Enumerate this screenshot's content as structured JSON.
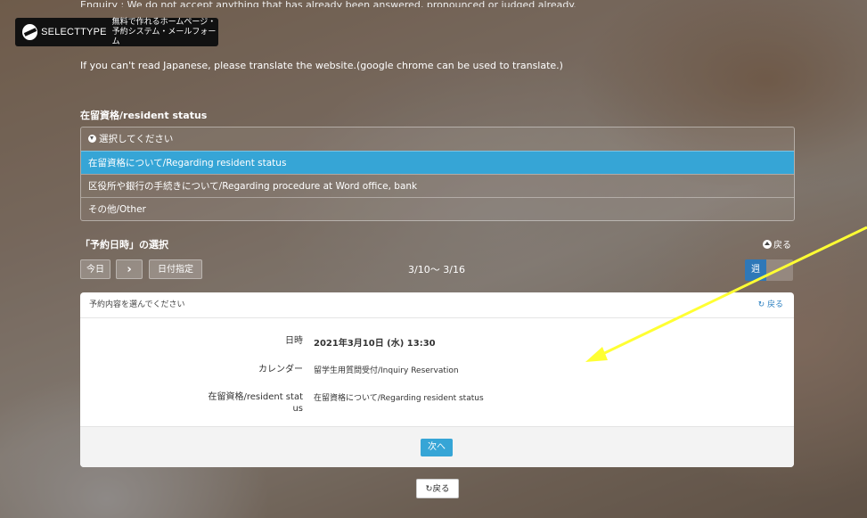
{
  "brand": {
    "name": "SELECTTYPE",
    "tagline_line1": "無料で作れるホームページ・",
    "tagline_line2": "予約システム・メールフォーム"
  },
  "top_partial_text": "Enquiry : We do not accept anything that has already been answered, pronounced or judged already.",
  "notice": "If you can't read Japanese, please translate the website.(google chrome can be used to translate.)",
  "resident_section": {
    "label": "在留資格/resident status",
    "options": [
      {
        "label": "選択してください",
        "placeholder": true
      },
      {
        "label": "在留資格について/Regarding resident status",
        "selected": true
      },
      {
        "label": "区役所や銀行の手続きについて/Regarding procedure at Word office, bank"
      },
      {
        "label": "その他/Other"
      }
    ]
  },
  "datetime_section": {
    "label": "「予約日時」の選択",
    "back_label": "戻る",
    "today_label": "今日",
    "next_arrow": "›",
    "date_pick_label": "日付指定",
    "range": "3/10～ 3/16",
    "week_label": "週"
  },
  "confirm_panel": {
    "heading": "予約内容を選んでください",
    "back_label": "戻る",
    "rows": [
      {
        "key": "日時",
        "value": "2021年3月10日 (水) 13:30"
      },
      {
        "key": "カレンダー",
        "value": "留学生用質問受付/Inquiry Reservation"
      },
      {
        "key": "在留資格/resident status",
        "value": "在留資格について/Regarding resident status"
      }
    ],
    "next_label": "次へ"
  },
  "bottom_back_label": "戻る",
  "colors": {
    "accent": "#36a5d6",
    "week_active": "#2e78b8",
    "annotation_arrow": "#ffff33"
  }
}
